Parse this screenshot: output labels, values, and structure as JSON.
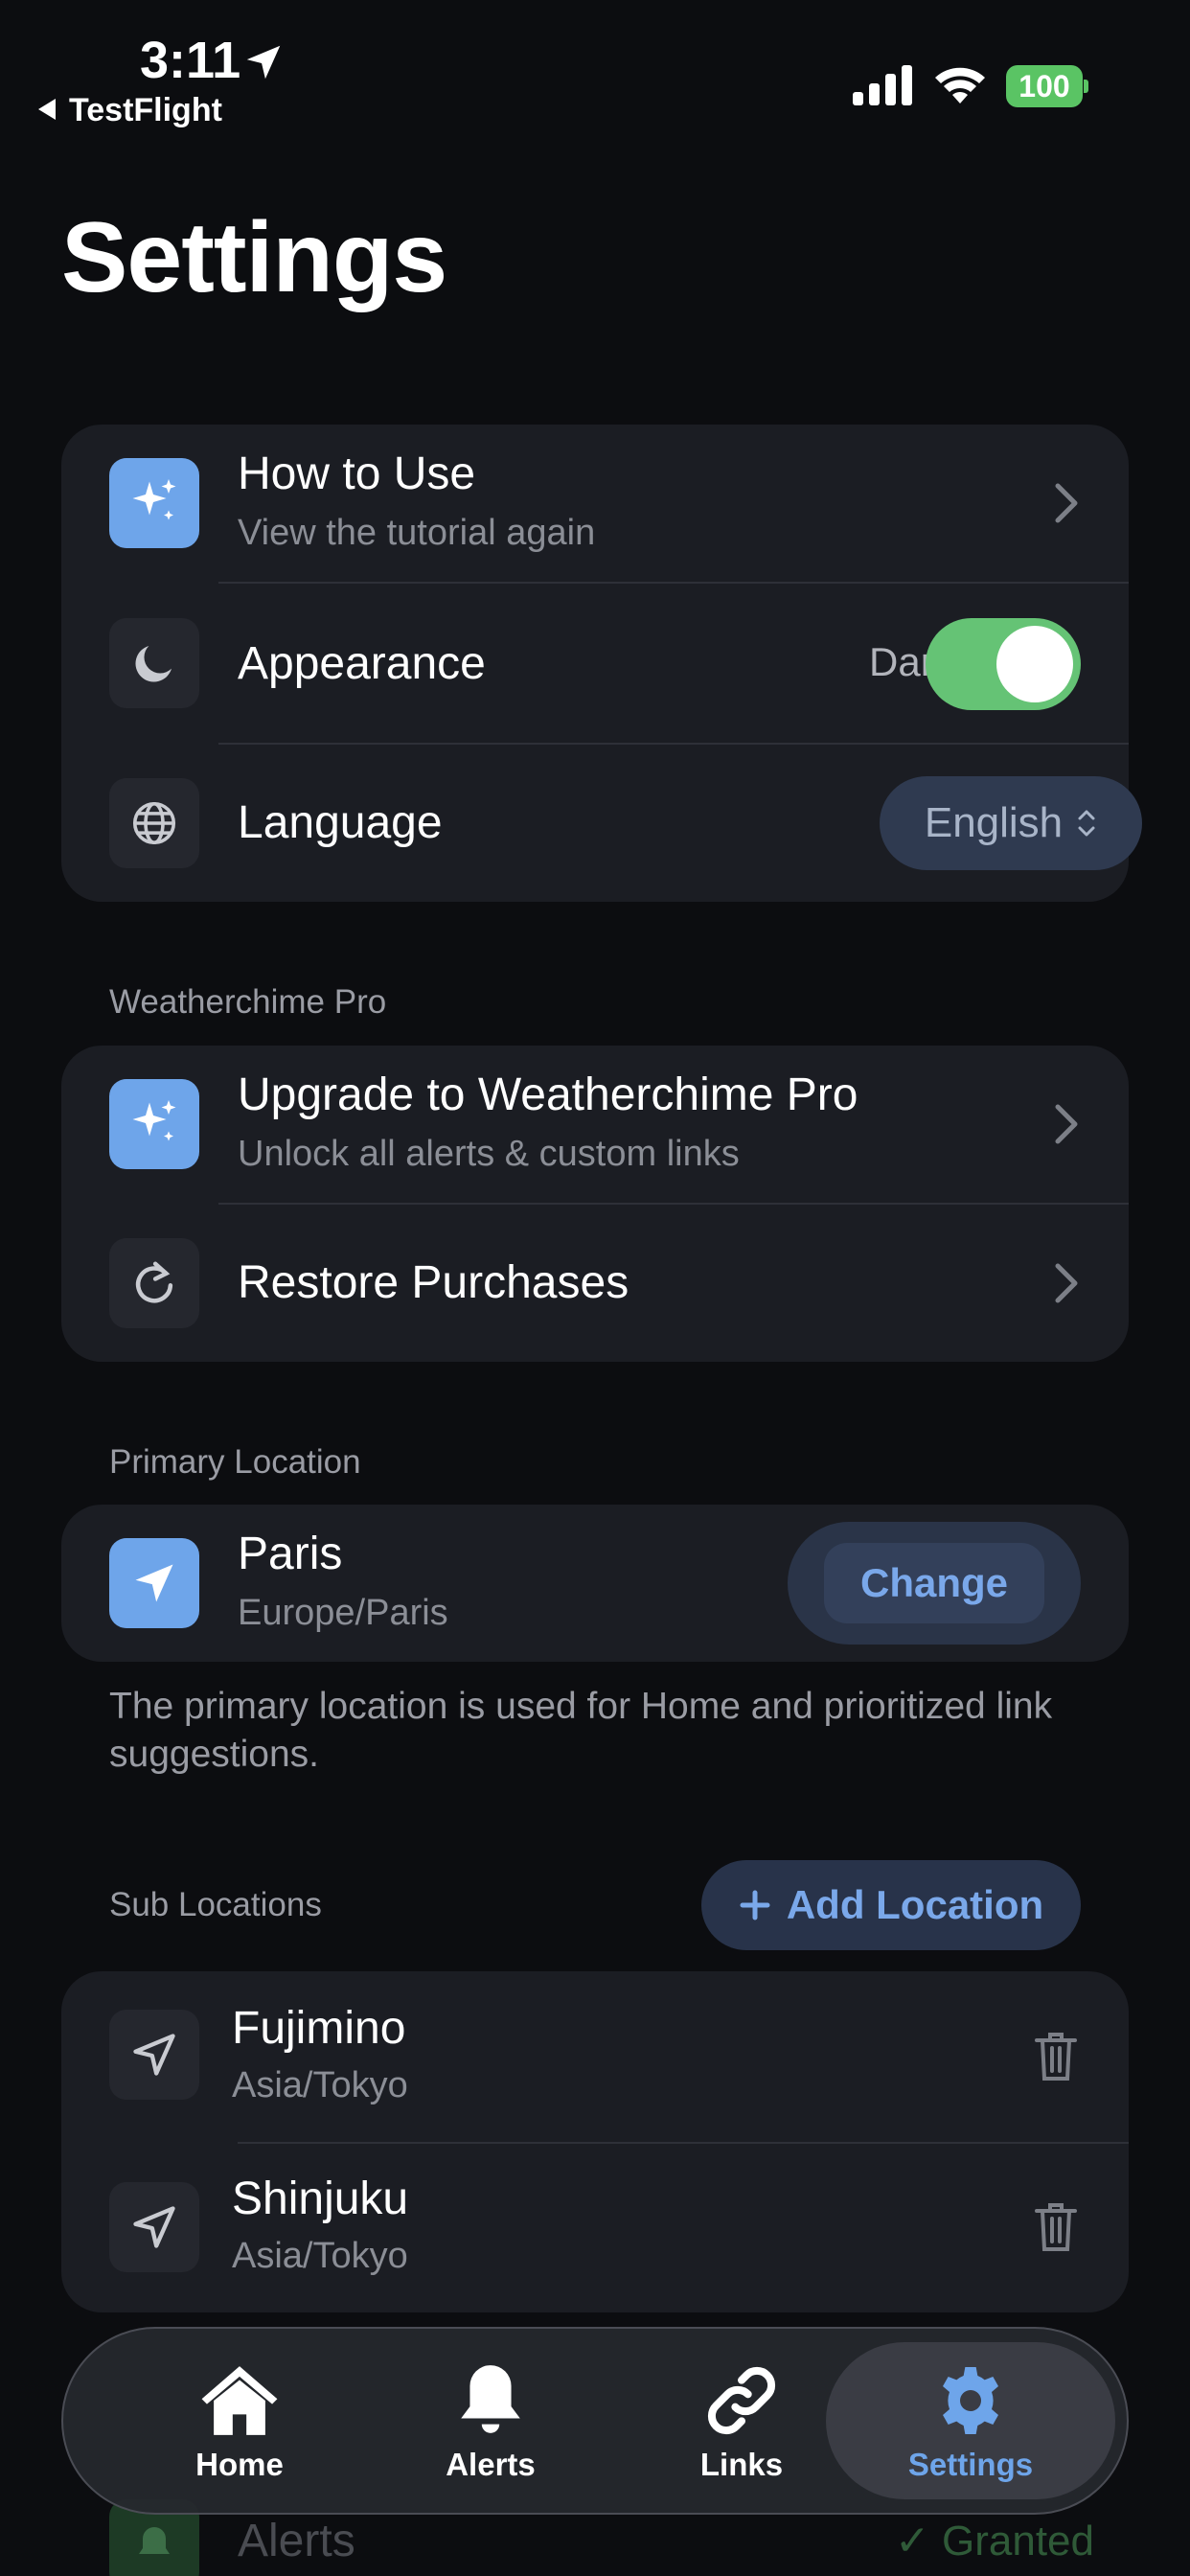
{
  "status_bar": {
    "time": "3:11",
    "back_label": "TestFlight",
    "battery": "100"
  },
  "page": {
    "title": "Settings"
  },
  "general": {
    "how_to_use": {
      "title": "How to Use",
      "subtitle": "View the tutorial again"
    },
    "appearance": {
      "title": "Appearance",
      "value": "Dark",
      "toggle_on": true
    },
    "language": {
      "title": "Language",
      "value": "English"
    }
  },
  "pro": {
    "section_label": "Weatherchime Pro",
    "upgrade": {
      "title": "Upgrade to Weatherchime Pro",
      "subtitle": "Unlock all alerts & custom links"
    },
    "restore": {
      "title": "Restore Purchases"
    }
  },
  "primary_location": {
    "section_label": "Primary Location",
    "name": "Paris",
    "timezone": "Europe/Paris",
    "change_label": "Change",
    "note": "The primary location is used for Home and prioritized link suggestions."
  },
  "sub_locations": {
    "section_label": "Sub Locations",
    "add_label": "Add Location",
    "items": [
      {
        "name": "Fujimino",
        "timezone": "Asia/Tokyo"
      },
      {
        "name": "Shinjuku",
        "timezone": "Asia/Tokyo"
      }
    ]
  },
  "notifications_peek": {
    "row_title": "Alerts",
    "row_value": "Granted"
  },
  "tab_bar": {
    "tabs": [
      {
        "label": "Home",
        "icon": "house-icon"
      },
      {
        "label": "Alerts",
        "icon": "bell-icon"
      },
      {
        "label": "Links",
        "icon": "link-icon"
      },
      {
        "label": "Settings",
        "icon": "gear-icon"
      }
    ],
    "active": "Settings"
  },
  "colors": {
    "background": "#0c0d10",
    "card": "#1b1d23",
    "accent_blue": "#6ea5ea",
    "toggle_green": "#65c375",
    "secondary_text": "#8b8e96"
  }
}
